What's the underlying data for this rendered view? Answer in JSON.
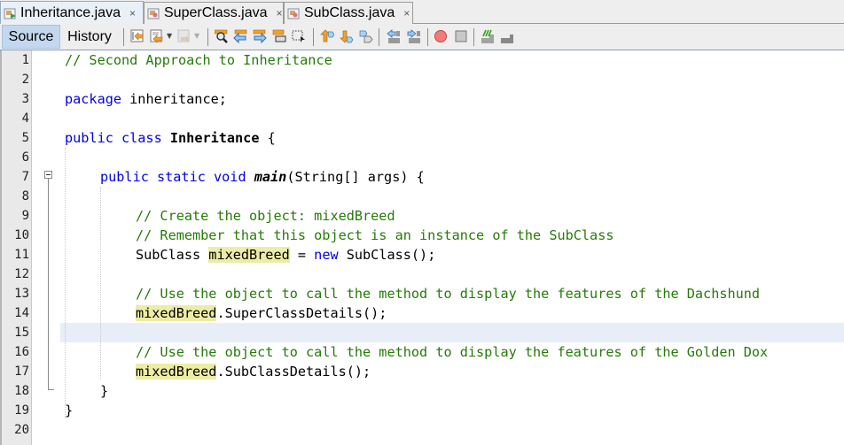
{
  "tabs": [
    {
      "label": "Inheritance.java",
      "active": true,
      "icon": "java-main-file-icon"
    },
    {
      "label": "SuperClass.java",
      "active": false,
      "icon": "java-file-icon"
    },
    {
      "label": "SubClass.java",
      "active": false,
      "icon": "java-file-icon"
    }
  ],
  "tab_close_glyph": "×",
  "toolbar": {
    "source_label": "Source",
    "history_label": "History",
    "icons": [
      "last-edit-icon",
      "back-icon",
      "forward-icon",
      "find-icon",
      "find-previous-icon",
      "find-next-icon",
      "toggle-highlight-icon",
      "select-rectangle-icon",
      "previous-bookmark-icon",
      "next-bookmark-icon",
      "toggle-bookmark-icon",
      "shift-left-icon",
      "shift-right-icon",
      "start-macro-icon",
      "stop-macro-icon",
      "comment-icon",
      "uncomment-icon"
    ]
  },
  "editor": {
    "current_line": 15,
    "line_numbers": [
      "1",
      "2",
      "3",
      "4",
      "5",
      "6",
      "7",
      "8",
      "9",
      "10",
      "11",
      "12",
      "13",
      "14",
      "15",
      "16",
      "17",
      "18",
      "19",
      "20"
    ],
    "lines": {
      "l1_comment": "// Second Approach to Inheritance",
      "l3_kw": "package",
      "l3_rest": " inheritance;",
      "l5_kw": "public class",
      "l5_name": "Inheritance",
      "l5_rest": " {",
      "l7_kw": "public static void",
      "l7_name": "main",
      "l7_rest": "(String[] args) {",
      "l9_comment": "// Create the object: mixedBreed",
      "l10_comment": "// Remember that this object is an instance of the SubClass",
      "l11_type": "SubClass ",
      "l11_var": "mixedBreed",
      "l11_eq": " = ",
      "l11_kw": "new",
      "l11_rest": " SubClass();",
      "l13_comment": "// Use the object to call the method to display the features of the Dachshund",
      "l14_var": "mixedBreed",
      "l14_rest": ".SuperClassDetails();",
      "l16_comment": "// Use the object to call the method to display the features of the Golden Dox",
      "l17_var": "mixedBreed",
      "l17_rest": ".SubClassDetails();",
      "l18": "}",
      "l19": "}"
    }
  }
}
